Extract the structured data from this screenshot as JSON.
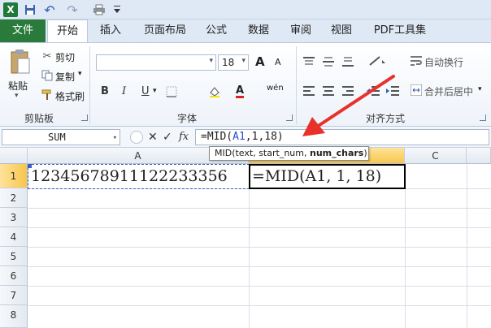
{
  "app": {
    "accent": "#2a7b3b",
    "title_bar_color": "#dfe9f5"
  },
  "quick_access": [
    {
      "icon": "excel-logo-icon",
      "label": "X"
    },
    {
      "icon": "save-icon",
      "label": ""
    },
    {
      "icon": "undo-icon",
      "label": "↶"
    },
    {
      "icon": "redo-icon",
      "label": "↷"
    },
    {
      "icon": "print-icon",
      "label": ""
    },
    {
      "icon": "customize-quick-access-icon",
      "label": ""
    }
  ],
  "ribbon_tabs": [
    "文件",
    "开始",
    "插入",
    "页面布局",
    "公式",
    "数据",
    "审阅",
    "视图",
    "PDF工具集"
  ],
  "clipboard": {
    "paste": "粘贴",
    "cut": "剪切",
    "copy": "复制",
    "format_painter": "格式刷",
    "label": "剪贴板"
  },
  "font": {
    "font_name": "",
    "font_size": "18",
    "bold": "B",
    "italic": "I",
    "underline": "U",
    "phonetic": "wén",
    "grow": "A",
    "shrink": "A",
    "font_color": "A",
    "label": "字体"
  },
  "alignment": {
    "wrap_text": "自动换行",
    "merge_center": "合并后居中",
    "label": "对齐方式"
  },
  "formula_bar": {
    "name_box": "SUM",
    "cancel": "✕",
    "enter": "✓",
    "fx": "fx",
    "formula_prefix": "=MID(",
    "formula_ref": "A1",
    "formula_suffix": ",1,18)"
  },
  "tooltip": {
    "prefix": "MID(text, start_num, ",
    "bold_arg": "num_chars",
    "suffix": ")"
  },
  "grid": {
    "columns": [
      "A",
      "B",
      "C"
    ],
    "rows": [
      "1",
      "2",
      "3",
      "4",
      "5",
      "6",
      "7",
      "8"
    ],
    "cells": {
      "A1": "1234567891112223335​6",
      "B1": "=MID(A1, 1, 18)"
    }
  },
  "annotation": {
    "arrow_color": "#e8312a"
  }
}
